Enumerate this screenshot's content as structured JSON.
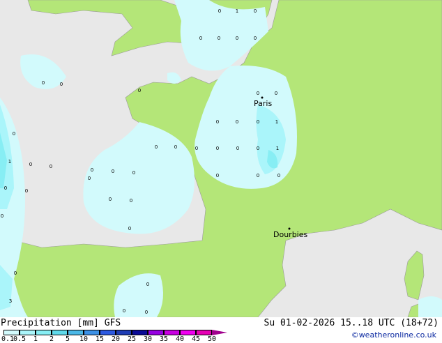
{
  "title": "Precipitation [mm]",
  "model": "GFS",
  "datetime": "Su 01-02-2026 15..18 UTC (18+72)",
  "credit": "©weatheronline.co.uk",
  "legend": {
    "ticks": [
      "0.1",
      "0.5",
      "1",
      "2",
      "5",
      "10",
      "15",
      "20",
      "25",
      "30",
      "35",
      "40",
      "45",
      "50"
    ],
    "colors": [
      "#d2fafc",
      "#aaf5fa",
      "#87eef4",
      "#5fd9ea",
      "#4bb7e6",
      "#3c91e6",
      "#2d5ae1",
      "#1e3cb4",
      "#0a0a96",
      "#9600e1",
      "#c800e1",
      "#f000f0",
      "#e600b4",
      "#a0008c"
    ]
  },
  "cities": [
    {
      "name": "Paris"
    },
    {
      "name": "Dourbies"
    }
  ],
  "colors": {
    "land": "#b4e678",
    "sea": "#e8e8e8",
    "rain_light": "#d2fafc",
    "rain_mid": "#aaf5fa",
    "rain_heavy": "#87eef4"
  },
  "values": [
    "0",
    "1"
  ]
}
